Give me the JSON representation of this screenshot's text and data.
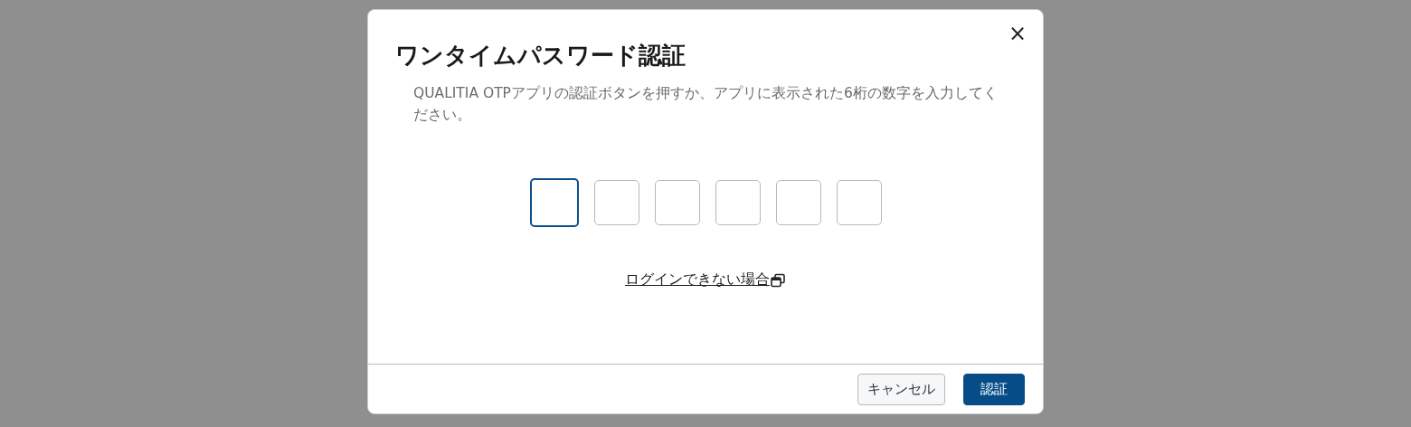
{
  "dialog": {
    "title": "ワンタイムパスワード認証",
    "close": "×",
    "description": "QUALITIA OTPアプリの認証ボタンを押すか、アプリに表示された6桁の数字を入力してください。",
    "digits": [
      {
        "focused": true
      },
      {
        "focused": false
      },
      {
        "focused": false
      },
      {
        "focused": false
      },
      {
        "focused": false
      },
      {
        "focused": false
      }
    ],
    "help_link": "ログインできない場合",
    "buttons": [
      {
        "label": "キャンセル",
        "kind": "secondary"
      },
      {
        "label": "認証",
        "kind": "primary"
      }
    ]
  }
}
